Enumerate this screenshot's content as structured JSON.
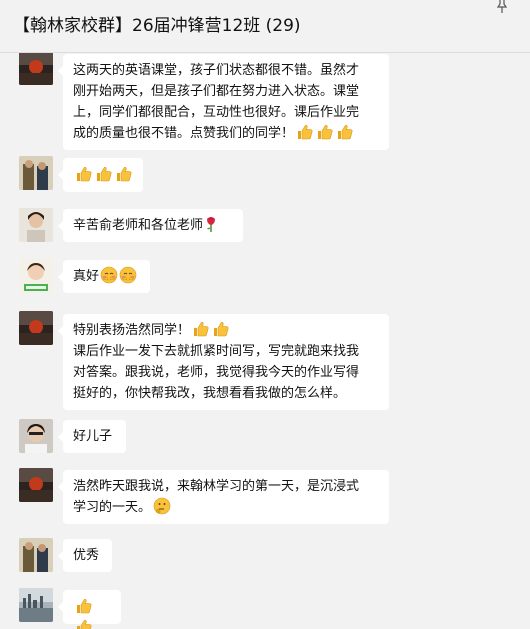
{
  "window": {
    "title": "【翰林家校群】26届冲锋营12班 (29)"
  },
  "messages": [
    {
      "avatar": "sunset-avatar",
      "lines": [
        "这两天的英语课堂，孩子们状态都很不错。虽然才",
        "刚开始两天，但是孩子们都在努力进入状态。课堂",
        "上，同学们都很配合，互动性也很好。课后作业完",
        "成的质量也很不错。点赞我们的同学！"
      ],
      "emoji": [
        "thumbs-up-emoji",
        "thumbs-up-emoji",
        "thumbs-up-emoji"
      ]
    },
    {
      "avatar": "couple-avatar",
      "lines": [
        ""
      ],
      "emoji": [
        "thumbs-up-emoji",
        "thumbs-up-emoji",
        "thumbs-up-emoji"
      ]
    },
    {
      "avatar": "woman-avatar",
      "lines": [
        "辛苦俞老师和各位老师"
      ],
      "emoji": [
        "rose-emoji"
      ]
    },
    {
      "avatar": "child-avatar",
      "lines": [
        "真好"
      ],
      "emoji": [
        "blush-emoji",
        "blush-emoji"
      ]
    },
    {
      "avatar": "sunset-avatar",
      "lines": [
        "特别表扬浩然同学！",
        "课后作业一发下去就抓紧时间写，写完就跑来找我",
        "对答案。跟我说，老师，我觉得我今天的作业写得",
        "挺好的，你快帮我改，我想看看我做的怎么样。"
      ],
      "emoji": [
        "thumbs-up-emoji",
        "thumbs-up-emoji"
      ]
    },
    {
      "avatar": "selfie-avatar",
      "lines": [
        "好儿子"
      ],
      "emoji": []
    },
    {
      "avatar": "sunset-avatar",
      "lines": [
        "浩然昨天跟我说，来翰林学习的第一天，是沉浸式",
        "学习的一天。"
      ],
      "emoji": [
        "thinking-emoji"
      ]
    },
    {
      "avatar": "couple-avatar",
      "lines": [
        "优秀"
      ],
      "emoji": []
    },
    {
      "avatar": "harbor-avatar",
      "lines": [
        ""
      ],
      "emoji": [
        "thumbs-up-emoji",
        "thumbs-up-emoji"
      ]
    }
  ]
}
